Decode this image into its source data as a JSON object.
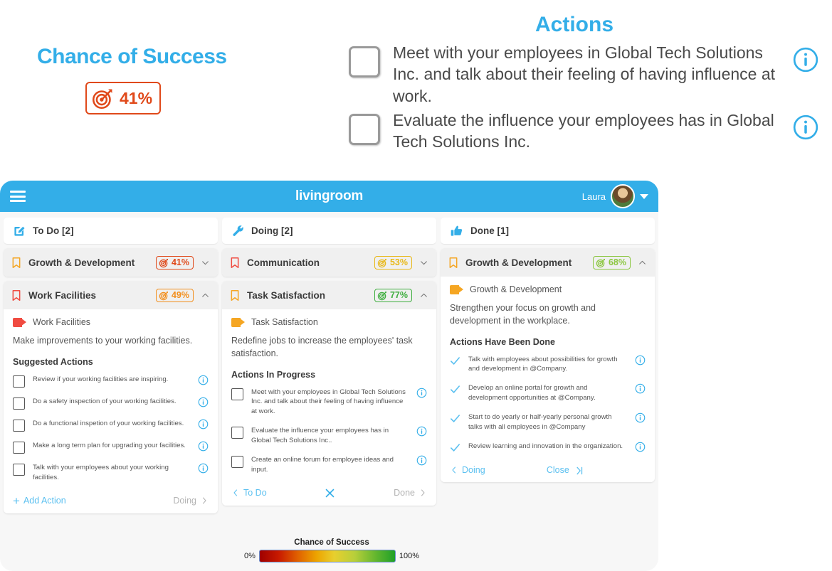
{
  "annotations": {
    "chance_title": "Chance of Success",
    "chance_value": "41%",
    "actions_title": "Actions",
    "action_items": [
      "Meet with your employees in Global Tech Solutions Inc. and talk about their feeling of having influence at work.",
      "Evaluate the influence your employees has in Global Tech Solutions Inc."
    ]
  },
  "app": {
    "title": "livingroom",
    "user_name": "Laura",
    "menu_icon": "hamburger-icon",
    "avatar_icon": "avatar",
    "caret_icon": "chevron-down-icon"
  },
  "columns": [
    {
      "tab": {
        "label": "To Do [2]",
        "icon": "edit-pencil-icon"
      },
      "stacks": [
        {
          "name": "Growth & Development",
          "bookmark_color": "#F5A623",
          "percent": "41%",
          "percent_color": "#E0491A",
          "expanded": false,
          "chevron": "chevron-down-icon"
        },
        {
          "name": "Work Facilities",
          "bookmark_color": "#F04B41",
          "percent": "49%",
          "percent_color": "#F28E1C",
          "expanded": true,
          "chevron": "chevron-up-icon",
          "tag_label": "Work Facilities",
          "tag_color": "#F04B41",
          "description": "Make improvements to your working facilities.",
          "section_title": "Suggested Actions",
          "items": [
            "Review if your working facilities are inspiring.",
            "Do a safety inspection of your working facilities.",
            "Do a functional inspetion of your working facilities.",
            "Make a long term plan for upgrading your facilities.",
            "Talk with your employees about your working facilities."
          ],
          "footer": {
            "left": "Add Action",
            "left_icon": "plus-icon",
            "mid": "",
            "mid_icon": "",
            "right": "Doing",
            "right_icon": "chevron-right-icon",
            "right_active": false
          }
        }
      ]
    },
    {
      "tab": {
        "label": "Doing [2]",
        "icon": "wrench-icon"
      },
      "stacks": [
        {
          "name": "Communication",
          "bookmark_color": "#F04B41",
          "percent": "53%",
          "percent_color": "#E8B818",
          "expanded": false,
          "chevron": "chevron-down-icon"
        },
        {
          "name": "Task Satisfaction",
          "bookmark_color": "#F5A623",
          "percent": "77%",
          "percent_color": "#3FAE3F",
          "expanded": true,
          "chevron": "chevron-up-icon",
          "tag_label": "Task Satisfaction",
          "tag_color": "#F5A623",
          "description": "Redefine jobs to increase the employees' task satisfaction.",
          "section_title": "Actions In Progress",
          "items": [
            "Meet with your employees in Global Tech Solutions Inc. and talk about their feeling of having influence at work.",
            "Evaluate the influence your employees has in Global Tech Solutions Inc..",
            "Create an online forum for employee ideas and input."
          ],
          "footer": {
            "left": "To Do",
            "left_icon": "chevron-left-icon",
            "mid": "",
            "mid_icon": "close-x-icon",
            "right": "Done",
            "right_icon": "chevron-right-icon",
            "right_active": false
          }
        }
      ]
    },
    {
      "tab": {
        "label": "Done [1]",
        "icon": "thumbs-up-icon"
      },
      "stacks": [
        {
          "name": "Growth & Development",
          "bookmark_color": "#F5A623",
          "percent": "68%",
          "percent_color": "#8BC63F",
          "expanded": true,
          "chevron": "chevron-up-icon",
          "tag_label": "Growth & Development",
          "tag_color": "#F5A623",
          "description": "Strengthen your focus on growth and development in the workplace.",
          "section_title": "Actions Have Been Done",
          "items": [
            "Talk with employees about possibilities for growth and development in @Company.",
            "Develop an online portal for growth and development opportunities at @Company.",
            "Start to do yearly or half-yearly personal growth talks with all employees in @Company",
            "Review learning and innovation in the organization."
          ],
          "footer": {
            "left": "Doing",
            "left_icon": "chevron-left-icon",
            "mid": "Close",
            "mid_icon": "skip-to-end-icon",
            "right": "",
            "right_icon": "",
            "right_active": false
          }
        }
      ]
    }
  ],
  "legend": {
    "title": "Chance of Success",
    "min": "0%",
    "max": "100%"
  },
  "colors": {
    "brand_blue": "#33AEE8",
    "link_blue": "#5BC0F0",
    "orange": "#E0491A"
  }
}
